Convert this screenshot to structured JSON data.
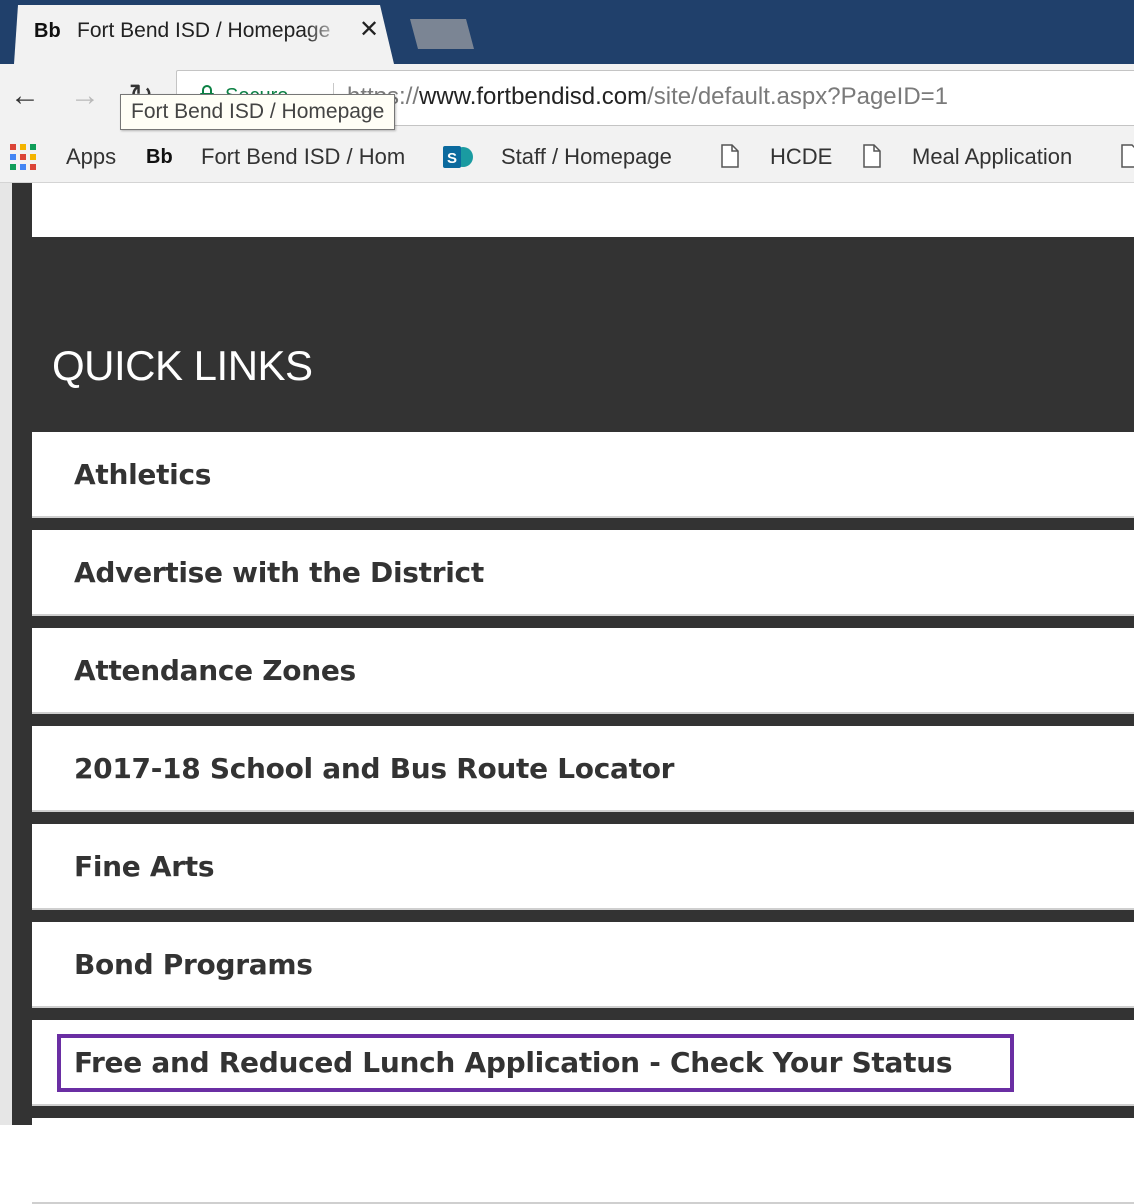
{
  "browser": {
    "tab": {
      "favicon_text": "Bb",
      "title": "Fort Bend ISD / Homepage",
      "close_glyph": "✕"
    },
    "toolbar": {
      "back_glyph": "←",
      "forward_glyph": "→",
      "reload_glyph": "↻",
      "secure_label": "Secure",
      "url_scheme": "https://",
      "url_host": "www.fortbendisd.com",
      "url_path": "/site/default.aspx?PageID=1",
      "tooltip": "Fort Bend ISD / Homepage"
    },
    "bookmarks": [
      {
        "icon": "apps-icon",
        "label": "Apps"
      },
      {
        "icon": "bb-icon",
        "icon_text": "Bb",
        "label": "Fort Bend ISD / Hom"
      },
      {
        "icon": "sharepoint-icon",
        "label": "Staff / Homepage"
      },
      {
        "icon": "document-icon",
        "label": "HCDE"
      },
      {
        "icon": "document-icon",
        "label": "Meal Application"
      }
    ]
  },
  "quick_links": {
    "heading": "QUICK LINKS",
    "items": [
      "Athletics",
      "Advertise with the District",
      "Attendance Zones",
      "2017-18 School and Bus Route Locator",
      "Fine Arts",
      "Bond Programs",
      "Free and Reduced Lunch Application - Check Your Status"
    ],
    "highlighted_index": 6,
    "highlight_color": "#6a2ea3"
  },
  "colors": {
    "tabstrip": "#20406b",
    "panel_dark": "#333333",
    "secure_green": "#0b8043"
  }
}
